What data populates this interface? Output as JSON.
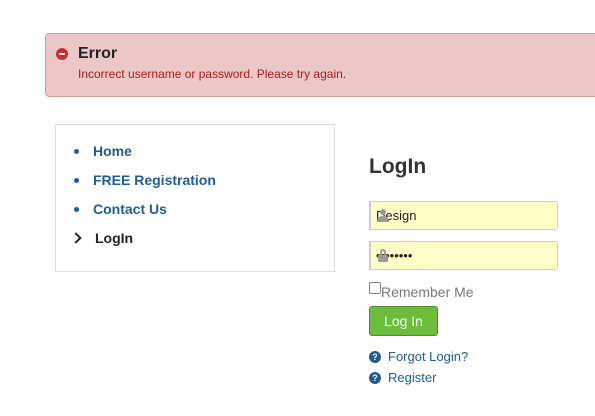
{
  "alert": {
    "title": "Error",
    "message": "Incorrect username or password. Please try again.",
    "icon": "minus-circle-icon",
    "color": "#cf2d2d"
  },
  "menu": {
    "items": [
      {
        "label": "Home",
        "active": false
      },
      {
        "label": "FREE Registration",
        "active": false
      },
      {
        "label": "Contact Us",
        "active": false
      },
      {
        "label": "LogIn",
        "active": true
      }
    ]
  },
  "login": {
    "title": "LogIn",
    "username": {
      "value": "Design",
      "icon": "user-icon"
    },
    "password": {
      "value": "••••••••",
      "icon": "lock-icon"
    },
    "remember_label": "Remember Me",
    "remember_checked": false,
    "submit_label": "Log In",
    "submit_color": "#6bbd3b",
    "forgot_label": "Forgot Login?",
    "register_label": "Register"
  }
}
